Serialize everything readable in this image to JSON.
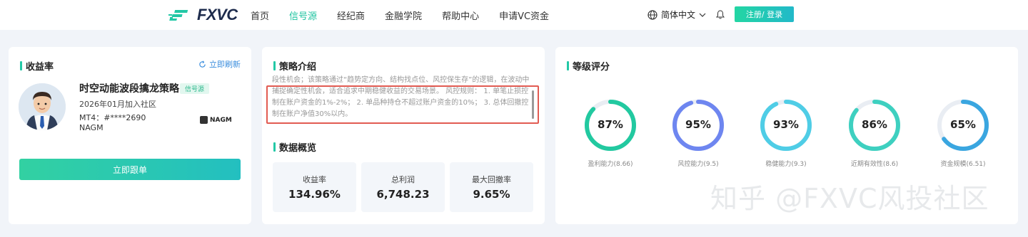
{
  "header": {
    "logo_text": "FXVC",
    "nav": [
      "首页",
      "信号源",
      "经纪商",
      "金融学院",
      "帮助中心",
      "申请VC资金"
    ],
    "active_nav": "信号源",
    "language": "简体中文",
    "login_label": "注册/ 登录"
  },
  "profile_card": {
    "title": "收益率",
    "refresh_label": "立即刷新",
    "strategy_name": "时空动能波段擒龙策略",
    "tag": "信号源",
    "join_date": "2026年01月加入社区",
    "mt4": "MT4：#****2690",
    "broker": "NAGM",
    "broker_logo_text": "NAGM",
    "follow_label": "立即跟单"
  },
  "strategy_card": {
    "intro_title": "策略介绍",
    "intro_text": "段性机会；该策略通过“趋势定方向、结构找点位、风控保生存”的逻辑，在波动中捕捉确定性机会，适合追求中期稳健收益的交易场景。 风控规则： 1. 单笔止损控制在账户资金的1%-2%； 2. 单品种持仓不超过账户资金的10%； 3. 总体回撤控制在账户净值30%以内。",
    "overview_title": "数据概览",
    "stats": [
      {
        "label": "收益率",
        "value": "134.96%"
      },
      {
        "label": "总利润",
        "value": "6,748.23"
      },
      {
        "label": "最大回撤率",
        "value": "9.65%"
      }
    ]
  },
  "rating_card": {
    "title": "等级评分",
    "gauges": [
      {
        "value": "87%",
        "percent": 87,
        "label": "盈利能力(8.66)",
        "color": "#22c9a0"
      },
      {
        "value": "95%",
        "percent": 95,
        "label": "风控能力(9.5)",
        "color": "#6e86f0"
      },
      {
        "value": "93%",
        "percent": 93,
        "label": "稳健能力(9.3)",
        "color": "#4fcde6"
      },
      {
        "value": "86%",
        "percent": 86,
        "label": "近期有效性(8.6)",
        "color": "#3ed0c0"
      },
      {
        "value": "65%",
        "percent": 65,
        "label": "资金规模(6.51)",
        "color": "#3aa6e0"
      }
    ]
  },
  "watermark": "知乎 @FXVC风投社区",
  "colors": {
    "accent": "#23c8a6",
    "link": "#3a8ddd",
    "highlight_border": "#e25b52"
  }
}
